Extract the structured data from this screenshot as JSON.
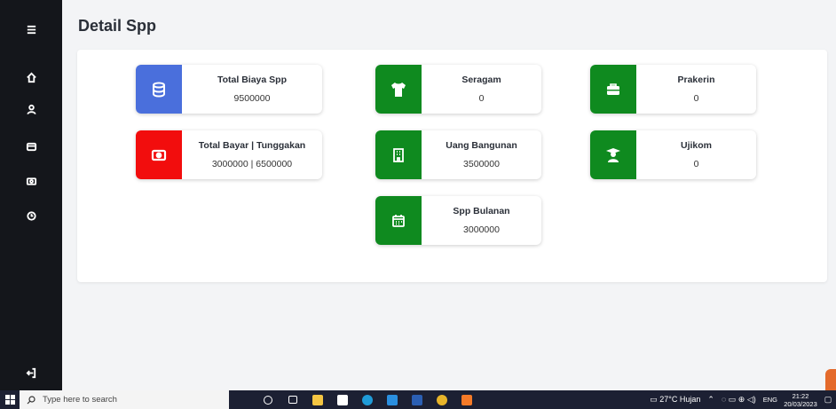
{
  "page": {
    "title": "Detail Spp"
  },
  "cards": {
    "total_biaya": {
      "label": "Total Biaya Spp",
      "value": "9500000",
      "icon": "database-icon",
      "color": "#4a6fdc"
    },
    "total_bayar": {
      "label": "Total Bayar | Tunggakan",
      "value": "3000000 | 6500000",
      "icon": "money-icon",
      "color": "#f20d0d"
    },
    "seragam": {
      "label": "Seragam",
      "value": "0",
      "icon": "shirt-icon",
      "color": "#0f8a1f"
    },
    "uang_bangunan": {
      "label": "Uang Bangunan",
      "value": "3500000",
      "icon": "building-icon",
      "color": "#0f8a1f"
    },
    "spp_bulanan": {
      "label": "Spp Bulanan",
      "value": "3000000",
      "icon": "calendar-icon",
      "color": "#0f8a1f"
    },
    "prakerin": {
      "label": "Prakerin",
      "value": "0",
      "icon": "briefcase-icon",
      "color": "#0f8a1f"
    },
    "ujikom": {
      "label": "Ujikom",
      "value": "0",
      "icon": "graduate-icon",
      "color": "#0f8a1f"
    }
  },
  "sidebar": {
    "items": [
      {
        "icon": "menu-icon"
      },
      {
        "icon": "home-icon"
      },
      {
        "icon": "user-icon"
      },
      {
        "icon": "wallet-icon"
      },
      {
        "icon": "money-icon"
      },
      {
        "icon": "history-icon"
      },
      {
        "icon": "logout-icon"
      }
    ]
  },
  "taskbar": {
    "search_placeholder": "Type here to search",
    "weather": "27°C Hujan",
    "language": "ENG",
    "time": "21:22",
    "date": "20/03/2023"
  }
}
